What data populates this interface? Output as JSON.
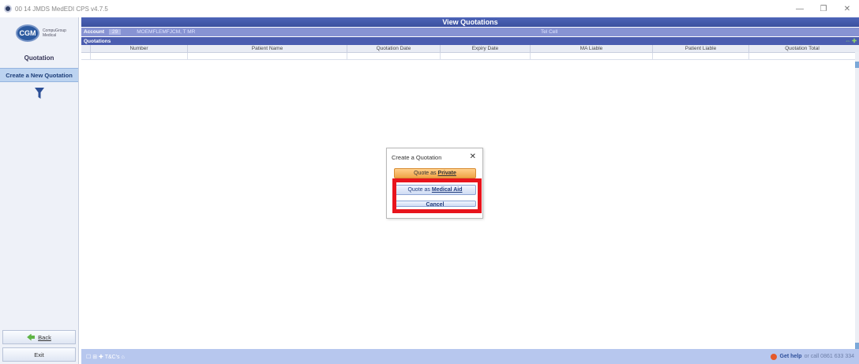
{
  "window": {
    "title": "00 14 JMDS MedEDI CPS v4.7.5",
    "minimize": "—",
    "maximize": "❐",
    "close": "✕"
  },
  "sidebar": {
    "logo_text": "CGM",
    "logo_subtext": "CompuGroup Medical",
    "heading": "Quotation",
    "new_quotation": "Create a New Quotation",
    "back": "Back",
    "exit": "Exit"
  },
  "main": {
    "title": "View Quotations",
    "account_label": "Account",
    "account_number": "29",
    "account_name": "MOEMFLEMFJCM, T MR",
    "tel": "Tel  Cell",
    "section_title": "Quotations",
    "section_tools": "⇔ ✚",
    "columns": [
      "Number",
      "Patient Name",
      "Quotation Date",
      "Expiry Date",
      "MA Liable",
      "Patient Liable",
      "Quotation Total"
    ]
  },
  "footer": {
    "icons": "☐  ⊞  ✚  T&C's  ⌂",
    "help_strong": "Get help",
    "help_rest": "or call 0861 633 334"
  },
  "dialog": {
    "title": "Create a Quotation",
    "close": "✕",
    "private_prefix": "Quote as",
    "private_bold": "Private",
    "medical_prefix": "Quote as",
    "medical_bold": "Medical Aid",
    "cancel": "Cancel"
  },
  "colors": {
    "title_bar": "#3b509e",
    "account_bar": "#8793d3",
    "highlight": "#e8141c",
    "private_button": "#f0a347"
  }
}
